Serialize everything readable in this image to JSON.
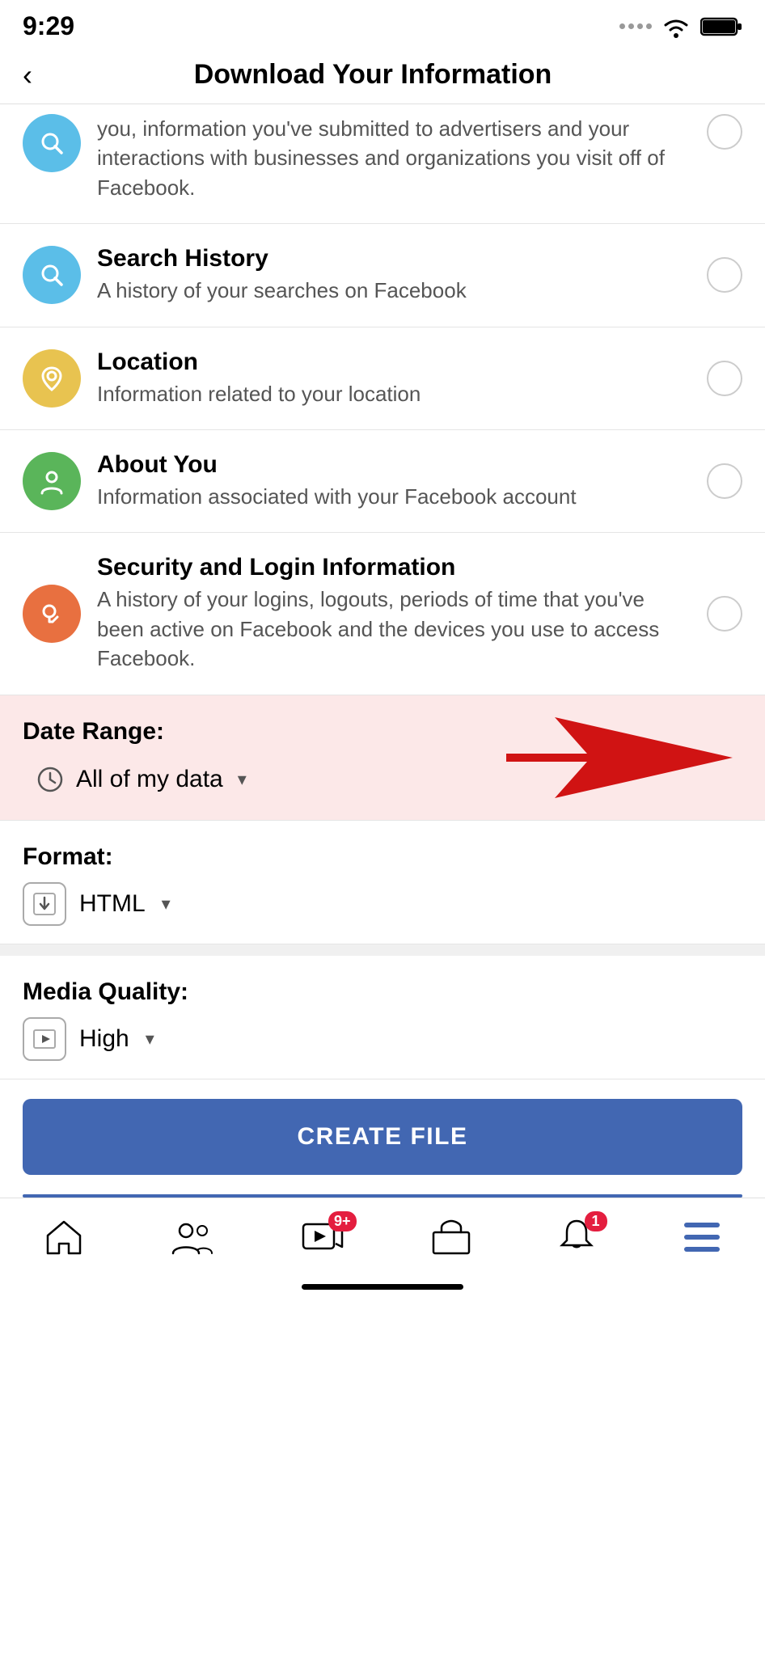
{
  "statusBar": {
    "time": "9:29"
  },
  "header": {
    "backLabel": "‹",
    "title": "Download Your Information"
  },
  "partialItem": {
    "description": "you, information you've submitted to advertisers and your interactions with businesses and organizations you visit off of Facebook."
  },
  "listItems": [
    {
      "id": "search-history",
      "iconColor": "icon-blue",
      "iconType": "search",
      "title": "Search History",
      "description": "A history of your searches on Facebook",
      "checked": false
    },
    {
      "id": "location",
      "iconColor": "icon-yellow",
      "iconType": "location",
      "title": "Location",
      "description": "Information related to your location",
      "checked": false
    },
    {
      "id": "about-you",
      "iconColor": "icon-green",
      "iconType": "person",
      "title": "About You",
      "description": "Information associated with your Facebook account",
      "checked": false
    },
    {
      "id": "security-login",
      "iconColor": "icon-orange",
      "iconType": "key",
      "title": "Security and Login Information",
      "description": "A history of your logins, logouts, periods of time that you've been active on Facebook and the devices you use to access Facebook.",
      "checked": false
    }
  ],
  "dateRange": {
    "label": "Date Range:",
    "value": "All of my data"
  },
  "format": {
    "label": "Format:",
    "value": "HTML"
  },
  "mediaQuality": {
    "label": "Media Quality:",
    "value": "High"
  },
  "createButton": {
    "label": "CREATE FILE"
  },
  "bottomNav": {
    "items": [
      {
        "id": "home",
        "icon": "home",
        "badge": ""
      },
      {
        "id": "friends",
        "icon": "friends",
        "badge": ""
      },
      {
        "id": "watch",
        "icon": "watch",
        "badge": "9+"
      },
      {
        "id": "marketplace",
        "icon": "marketplace",
        "badge": ""
      },
      {
        "id": "notifications",
        "icon": "bell",
        "badge": "1"
      },
      {
        "id": "menu",
        "icon": "menu",
        "badge": ""
      }
    ]
  }
}
